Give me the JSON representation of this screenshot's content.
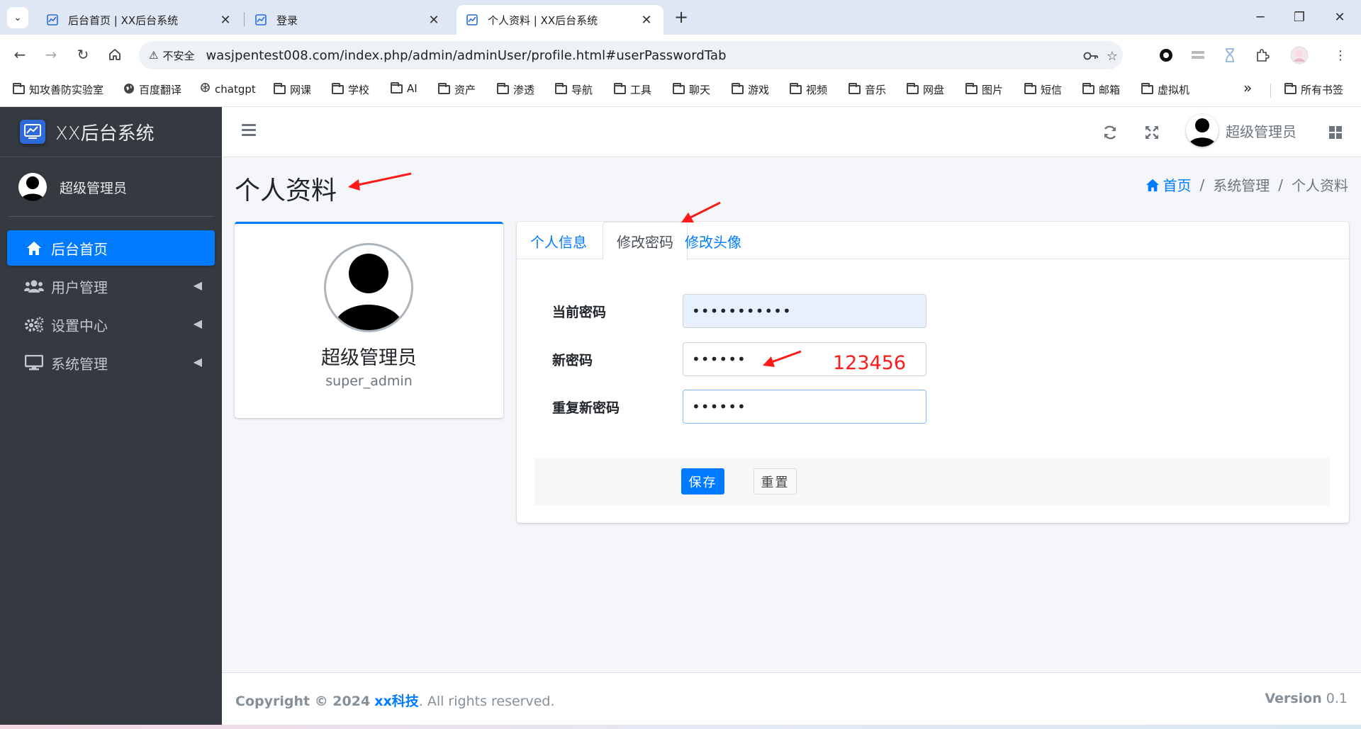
{
  "browser": {
    "tabs": [
      {
        "title": "后台首页 | XX后台系统",
        "active": false
      },
      {
        "title": "登录",
        "active": false
      },
      {
        "title": "个人资料 | XX后台系统",
        "active": true
      }
    ],
    "security_label": "不安全",
    "url": "wasjpentest008.com/index.php/admin/adminUser/profile.html#userPasswordTab",
    "bookmarks": [
      "知攻善防实验室",
      "百度翻译",
      "chatgpt",
      "网课",
      "学校",
      "AI",
      "资产",
      "渗透",
      "导航",
      "工具",
      "聊天",
      "游戏",
      "视频",
      "音乐",
      "网盘",
      "图片",
      "短信",
      "邮箱",
      "虚拟机"
    ],
    "bookmarks_more": "»",
    "all_bookmarks": "所有书签"
  },
  "app": {
    "brand": "XX后台系统",
    "sidebar_user": "超级管理员",
    "nav": [
      {
        "label": "后台首页",
        "icon": "home-icon",
        "active": true
      },
      {
        "label": "用户管理",
        "icon": "users-icon",
        "active": false
      },
      {
        "label": "设置中心",
        "icon": "cogs-icon",
        "active": false
      },
      {
        "label": "系统管理",
        "icon": "desktop-icon",
        "active": false
      }
    ],
    "topnav_user": "超级管理员"
  },
  "page": {
    "title": "个人资料",
    "breadcrumb": [
      "首页",
      "系统管理",
      "个人资料"
    ],
    "breadcrumb_sep": "/"
  },
  "profile": {
    "name": "超级管理员",
    "username": "super_admin"
  },
  "tabs": [
    "个人信息",
    "修改密码",
    "修改头像"
  ],
  "active_tab": "修改密码",
  "form": {
    "current_password_label": "当前密码",
    "current_password_value": "•••••••••••",
    "new_password_label": "新密码",
    "new_password_value": "••••••",
    "repeat_password_label": "重复新密码",
    "repeat_password_value": "••••••",
    "save_label": "保存",
    "reset_label": "重置"
  },
  "annotation": {
    "note": "123456",
    "color": "#ff1a1a"
  },
  "footer": {
    "copyright_prefix": "Copyright © 2024",
    "company": "xx科技",
    "suffix": ". All rights reserved.",
    "version_label": "Version",
    "version": "0.1"
  },
  "colors": {
    "primary": "#007bff",
    "sidebar": "#343a40"
  }
}
